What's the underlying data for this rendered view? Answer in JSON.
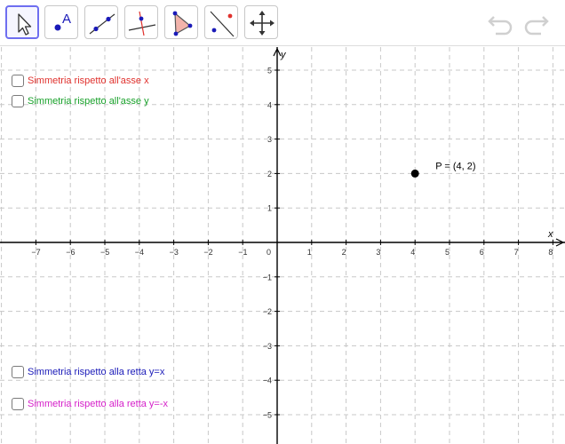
{
  "toolbar": {
    "tools": [
      {
        "name": "move-tool",
        "icon": "cursor-arrow-icon",
        "selected": true
      },
      {
        "name": "point-tool",
        "icon": "point-icon",
        "selected": false,
        "glyph": "A"
      },
      {
        "name": "line-tool",
        "icon": "line-through-points-icon",
        "selected": false
      },
      {
        "name": "perpendicular-line-tool",
        "icon": "perpendicular-line-icon",
        "selected": false
      },
      {
        "name": "polygon-tool",
        "icon": "polygon-icon",
        "selected": false
      },
      {
        "name": "reflect-about-line-tool",
        "icon": "reflect-about-line-icon",
        "selected": false
      },
      {
        "name": "move-graphics-view-tool",
        "icon": "move-graphics-view-icon",
        "selected": false
      }
    ],
    "undo_icon": "undo-icon",
    "redo_icon": "redo-icon"
  },
  "graphics": {
    "x_axis_label": "x",
    "y_axis_label": "y",
    "x_ticks": [
      "−7",
      "−6",
      "−5",
      "−4",
      "−3",
      "−2",
      "−1",
      "0",
      "1",
      "2",
      "3",
      "4",
      "5",
      "6",
      "7",
      "8"
    ],
    "y_ticks": [
      "5",
      "4",
      "3",
      "2",
      "1",
      "−1",
      "−2",
      "−3",
      "−4",
      "−5"
    ],
    "x_range": [
      -8,
      8.3
    ],
    "y_range": [
      -5.7,
      5.9
    ],
    "grid": true,
    "point": {
      "label": "P = (4, 2)",
      "x": 4,
      "y": 2
    }
  },
  "checkboxes": [
    {
      "label": "Simmetria rispetto all'asse x",
      "checked": false,
      "color": "#e0312d"
    },
    {
      "label": "Simmetria rispetto all'asse y",
      "checked": false,
      "color": "#18a12a"
    },
    {
      "label": "Simmetria rispetto alla retta y=x",
      "checked": false,
      "color": "#1a1ab8"
    },
    {
      "label": "Simmetria rispetto alla retta y=-x",
      "checked": false,
      "color": "#d51fc9"
    }
  ],
  "colors": {
    "grid": "#c8c8c8",
    "axis": "#000000",
    "accent": "#6e6ef0",
    "tool_blue": "#1a1ab8",
    "tool_red": "#e0312d",
    "undo_redo": "#d0d0d0"
  }
}
